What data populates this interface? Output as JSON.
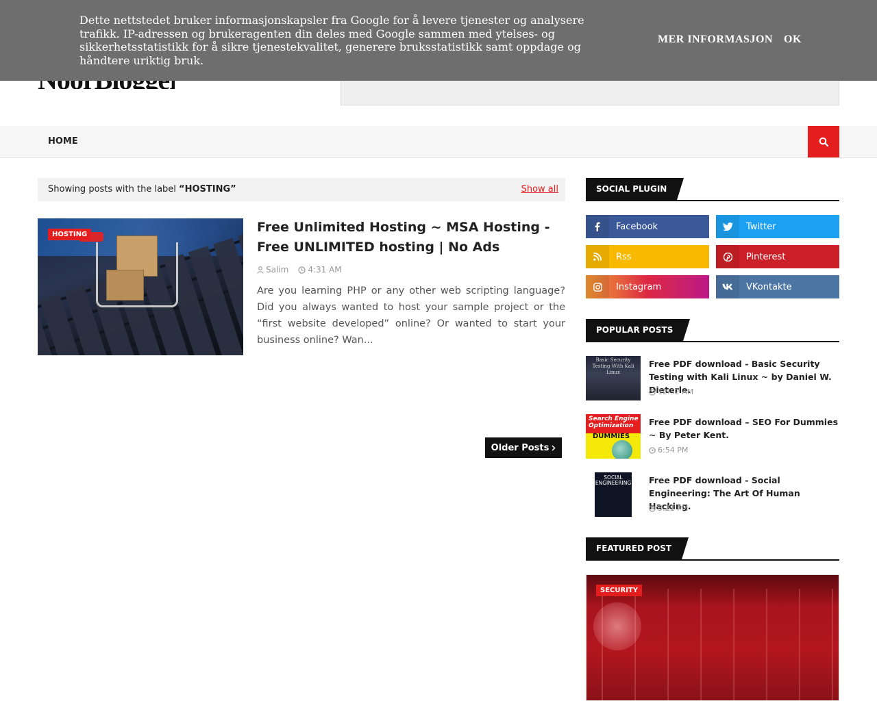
{
  "header": {
    "logo_text": "NoorBlogger"
  },
  "cookie_bar": {
    "text": "Dette nettstedet bruker informasjonskapsler fra Google for å levere tjenester og analysere trafikk. IP-adressen og brukeragenten din deles med Google sammen med ytelses- og sikkerhetsstatistikk for å sikre tjenestekvalitet, generere bruksstatistikk samt oppdage og håndtere uriktig bruk.",
    "more_label": "Mer informasjon",
    "ok_label": "OK"
  },
  "nav": {
    "home_label": "HOME"
  },
  "label_bar": {
    "prefix": "Showing posts with the label ",
    "label": "“HOSTING”",
    "show_all": "Show all"
  },
  "post": {
    "tag": "HOSTING",
    "title": "Free Unlimited Hosting ~ MSA Hosting - Free UNLIMITED hosting | No Ads",
    "author": "Salim",
    "time": "4:31 AM",
    "snippet": "Are you learning PHP or any other web scripting language? Did you always wanted to host your sample project or the “first website developed” online? Or wanted to start your business online? Wan..."
  },
  "pagination": {
    "older_label": "Older Posts"
  },
  "sidebar": {
    "social_title": "SOCIAL PLUGIN",
    "social": [
      {
        "label": "Facebook",
        "icon": "facebook-icon"
      },
      {
        "label": "Twitter",
        "icon": "twitter-icon"
      },
      {
        "label": "Rss",
        "icon": "rss-icon"
      },
      {
        "label": "Pinterest",
        "icon": "pinterest-icon"
      },
      {
        "label": "Instagram",
        "icon": "instagram-icon"
      },
      {
        "label": "VKontakte",
        "icon": "vk-icon"
      }
    ],
    "popular_title": "POPULAR POSTS",
    "popular": [
      {
        "title": "Free PDF download - Basic Security Testing with Kali Linux ~ by Daniel W. Dieterle.",
        "time": "12:52 AM",
        "thumb_text": "Basic Security Testing With Kali Linux"
      },
      {
        "title": "Free PDF download – SEO For Dummies ~ By Peter Kent.",
        "time": "6:54 PM",
        "thumb_text": "Search Engine Optimization",
        "thumb_text2": "DUMMIES"
      },
      {
        "title": "Free PDF download - Social Engineering: The Art Of Human Hacking.",
        "time": "3:21 PM",
        "thumb_text": "SOCIAL ENGINEERING"
      }
    ],
    "featured_title": "FEATURED POST",
    "featured_tag": "SECURITY"
  },
  "colors": {
    "accent": "#e41e1e",
    "cookie_bg": "#6e6e6e",
    "dark": "#111111"
  }
}
